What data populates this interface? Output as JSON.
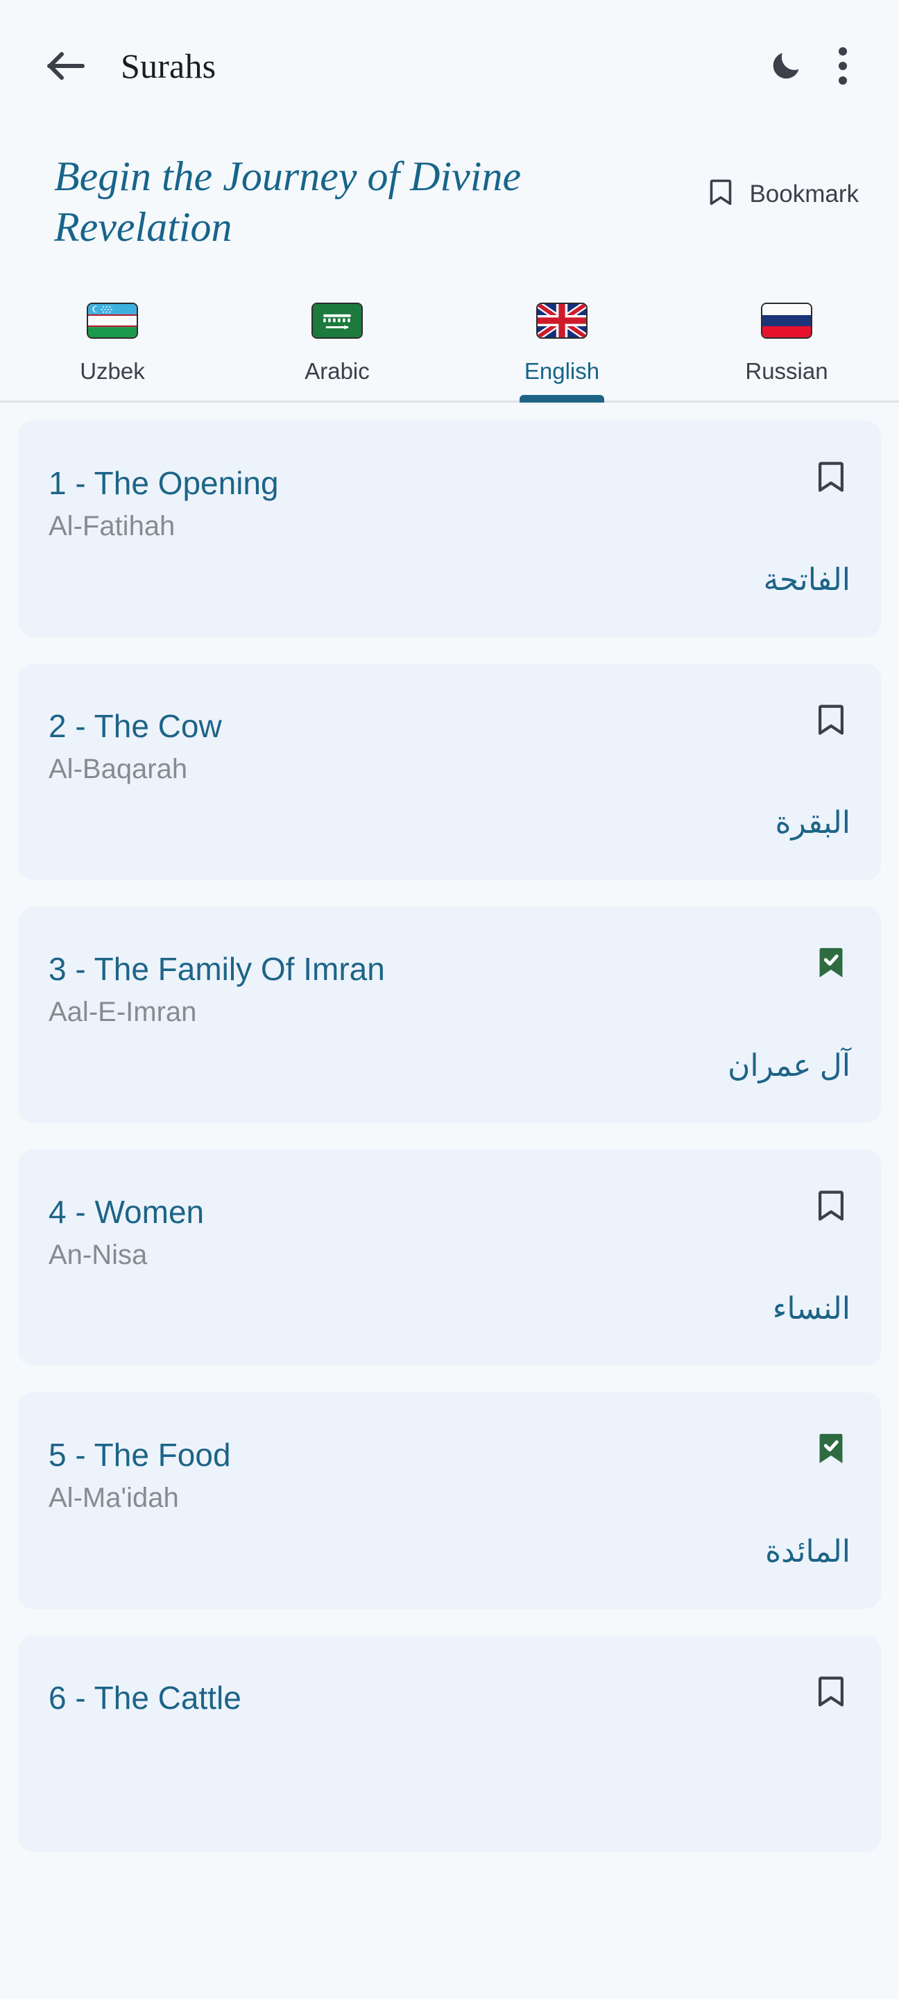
{
  "appbar": {
    "title": "Surahs",
    "back_icon": "arrow-left-icon",
    "theme_icon": "moon-icon",
    "overflow_icon": "more-vertical-icon"
  },
  "hero": {
    "title": "Begin the Journey of Divine Revelation",
    "bookmark_label": "Bookmark",
    "bookmark_icon": "bookmark-outline-icon"
  },
  "tabs": {
    "active": "English",
    "items": [
      {
        "label": "Uzbek",
        "flag": "flag-uzbekistan",
        "active": false
      },
      {
        "label": "Arabic",
        "flag": "flag-saudi-arabia",
        "active": false
      },
      {
        "label": "English",
        "flag": "flag-united-kingdom",
        "active": true
      },
      {
        "label": "Russian",
        "flag": "flag-russia",
        "active": false
      }
    ]
  },
  "surahs": [
    {
      "name": "1 - The Opening",
      "transliteration": "Al-Fatihah",
      "arabic": "الفاتحة",
      "bookmarked": false,
      "bookmark_icon": "bookmark-outline-icon"
    },
    {
      "name": "2 - The Cow",
      "transliteration": "Al-Baqarah",
      "arabic": "البقرة",
      "bookmarked": false,
      "bookmark_icon": "bookmark-outline-icon"
    },
    {
      "name": "3 - The Family Of Imran",
      "transliteration": "Aal-E-Imran",
      "arabic": "آل عمران",
      "bookmarked": true,
      "bookmark_icon": "bookmark-check-filled-icon"
    },
    {
      "name": "4 - Women",
      "transliteration": "An-Nisa",
      "arabic": "النساء",
      "bookmarked": false,
      "bookmark_icon": "bookmark-outline-icon"
    },
    {
      "name": "5 - The Food",
      "transliteration": "Al-Ma'idah",
      "arabic": "المائدة",
      "bookmarked": true,
      "bookmark_icon": "bookmark-check-filled-icon"
    },
    {
      "name": "6 - The Cattle",
      "transliteration": "",
      "arabic": "",
      "bookmarked": false,
      "bookmark_icon": "bookmark-outline-icon"
    }
  ],
  "colors": {
    "page_background": "#f5f9fc",
    "card_background": "#edf3fb",
    "accent_teal": "#1d6487",
    "hero_teal": "#18648a",
    "muted_text": "#878b90",
    "icon_dark": "#3b4049",
    "bookmarked_green": "#2e6b41",
    "divider": "#dfe3e6"
  }
}
